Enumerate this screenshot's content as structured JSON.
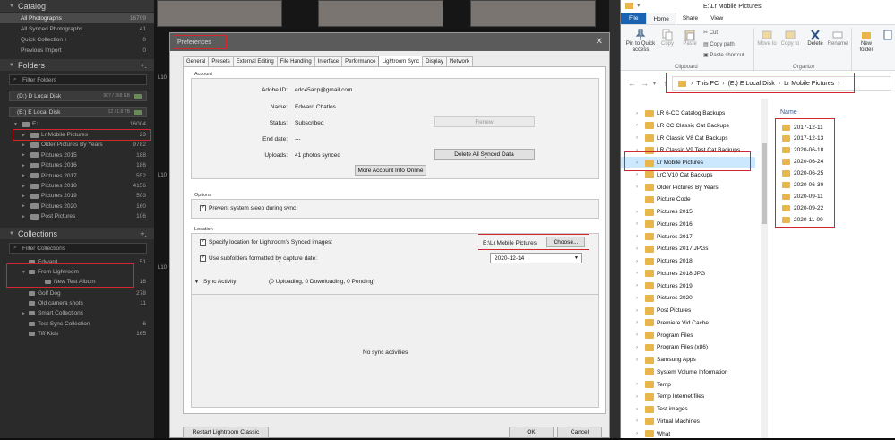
{
  "lightroom": {
    "catalog": {
      "header": "Catalog",
      "items": [
        {
          "label": "All Photographs",
          "count": "16709",
          "selected": true
        },
        {
          "label": "All Synced Photographs",
          "count": "41"
        },
        {
          "label": "Quick Collection +",
          "count": "0"
        },
        {
          "label": "Previous Import",
          "count": "0"
        }
      ]
    },
    "folders": {
      "header": "Folders",
      "plus": "+.",
      "filter_placeholder": "Filter Folders",
      "disk_d": {
        "label": "(D:) D Local Disk",
        "size": "907 / 368 GB"
      },
      "disk_e": {
        "label": "(E:) E Local Disk",
        "size": "12 / 1.8 TB"
      },
      "root": {
        "label": "E:",
        "count": "16004"
      },
      "items": [
        {
          "label": "Lr Mobile Pictures",
          "count": "23"
        },
        {
          "label": "Older Pictures By Years",
          "count": "9782"
        },
        {
          "label": "Pictures 2015",
          "count": "188"
        },
        {
          "label": "Pictures 2016",
          "count": "186"
        },
        {
          "label": "Pictures 2017",
          "count": "552"
        },
        {
          "label": "Pictures 2018",
          "count": "4156"
        },
        {
          "label": "Pictures 2019",
          "count": "503"
        },
        {
          "label": "Pictures 2020",
          "count": "160"
        },
        {
          "label": "Post Pictures",
          "count": "106"
        }
      ]
    },
    "collections": {
      "header": "Collections",
      "plus": "+.",
      "filter_placeholder": "Filter Collections",
      "items": [
        {
          "label": "Edward",
          "count": "51"
        },
        {
          "label": "From Lightroom",
          "count": ""
        },
        {
          "label": "New Test Album",
          "count": "18"
        },
        {
          "label": "Golf Dog",
          "count": "278"
        },
        {
          "label": "Old camera shots",
          "count": "11"
        },
        {
          "label": "Smart Collections",
          "count": ""
        },
        {
          "label": "Test Sync Collection",
          "count": "6"
        },
        {
          "label": "Tiff Kids",
          "count": "165"
        }
      ]
    },
    "thumb_labels": [
      "L10",
      "L10",
      "L10"
    ]
  },
  "prefs": {
    "title": "Preferences",
    "close": "✕",
    "tabs": [
      "General",
      "Presets",
      "External Editing",
      "File Handling",
      "Interface",
      "Performance",
      "Lightroom Sync",
      "Display",
      "Network"
    ],
    "account": {
      "group_label": "Account",
      "adobe_id_label": "Adobe ID:",
      "adobe_id": "edc45acp@gmail.com",
      "name_label": "Name:",
      "name": "Edward Chatlos",
      "status_label": "Status:",
      "status": "Subscribed",
      "end_date_label": "End date:",
      "end_date": "---",
      "uploads_label": "Uploads:",
      "uploads": "41 photos synced",
      "renew": "Renew",
      "delete_all": "Delete All Synced Data",
      "more_info": "More Account Info Online"
    },
    "options": {
      "group_label": "Options",
      "prevent_sleep": "Prevent system sleep during sync",
      "prevent_sleep_checked": true
    },
    "location": {
      "group_label": "Location",
      "specify_label": "Specify location for Lightroom's Synced images:",
      "specify_checked": true,
      "path": "E:\\Lr Mobile Pictures",
      "choose": "Choose...",
      "subfolders_label": "Use subfolders formatted by capture date:",
      "subfolders_checked": true,
      "date_format": "2020-12-14"
    },
    "sync": {
      "label": "Sync Activity",
      "status": "(0 Uploading, 0 Downloading, 0 Pending)",
      "empty": "No sync activities"
    },
    "restart": "Restart Lightroom Classic",
    "ok": "OK",
    "cancel": "Cancel"
  },
  "explorer": {
    "title": "E:\\Lr Mobile Pictures",
    "menu": [
      "File",
      "Home",
      "Share",
      "View"
    ],
    "ribbon": {
      "pin": "Pin to Quick access",
      "copy": "Copy",
      "paste": "Paste",
      "cut": "Cut",
      "copy_path": "Copy path",
      "paste_shortcut": "Paste shortcut",
      "clipboard": "Clipboard",
      "move_to": "Move to",
      "copy_to": "Copy to",
      "delete": "Delete",
      "rename": "Rename",
      "organize": "Organize",
      "new_folder": "New folder"
    },
    "breadcrumb": [
      "This PC",
      "(E:) E Local Disk",
      "Lr Mobile Pictures"
    ],
    "nav_items": [
      {
        "label": "LR 6-CC Catalog Backups",
        "chevron": true
      },
      {
        "label": "LR CC Classic Cat Backups",
        "chevron": true
      },
      {
        "label": "LR Classic V8 Cat Backups",
        "chevron": true
      },
      {
        "label": "LR Classic V9 Test Cat Backups",
        "chevron": true
      },
      {
        "label": "Lr Mobile Pictures",
        "chevron": true,
        "selected": true
      },
      {
        "label": "LrC V10 Cat Backups",
        "chevron": true
      },
      {
        "label": "Older Pictures By Years",
        "chevron": true
      },
      {
        "label": "Picture Code",
        "chevron": false
      },
      {
        "label": "Pictures 2015",
        "chevron": true
      },
      {
        "label": "Pictures 2016",
        "chevron": true
      },
      {
        "label": "Pictures 2017",
        "chevron": true
      },
      {
        "label": "Pictures 2017 JPGs",
        "chevron": true
      },
      {
        "label": "Pictures 2018",
        "chevron": true
      },
      {
        "label": "Pictures 2018 JPG",
        "chevron": true
      },
      {
        "label": "Pictures 2019",
        "chevron": true
      },
      {
        "label": "Pictures 2020",
        "chevron": true
      },
      {
        "label": "Post Pictures",
        "chevron": true
      },
      {
        "label": "Premiere Vid Cache",
        "chevron": true
      },
      {
        "label": "Program Files",
        "chevron": true
      },
      {
        "label": "Program Files (x86)",
        "chevron": true
      },
      {
        "label": "Samsung Apps",
        "chevron": true
      },
      {
        "label": "System Volume Information",
        "chevron": false
      },
      {
        "label": "Temp",
        "chevron": true
      },
      {
        "label": "Temp Internet files",
        "chevron": true
      },
      {
        "label": "Test images",
        "chevron": true
      },
      {
        "label": "Virtual Machines",
        "chevron": true
      },
      {
        "label": "What",
        "chevron": true
      }
    ],
    "column_name": "Name",
    "files": [
      "2017-12-11",
      "2017-12-13",
      "2020-06-18",
      "2020-06-24",
      "2020-06-25",
      "2020-06-30",
      "2020-09-11",
      "2020-09-22",
      "2020-11-09"
    ]
  }
}
